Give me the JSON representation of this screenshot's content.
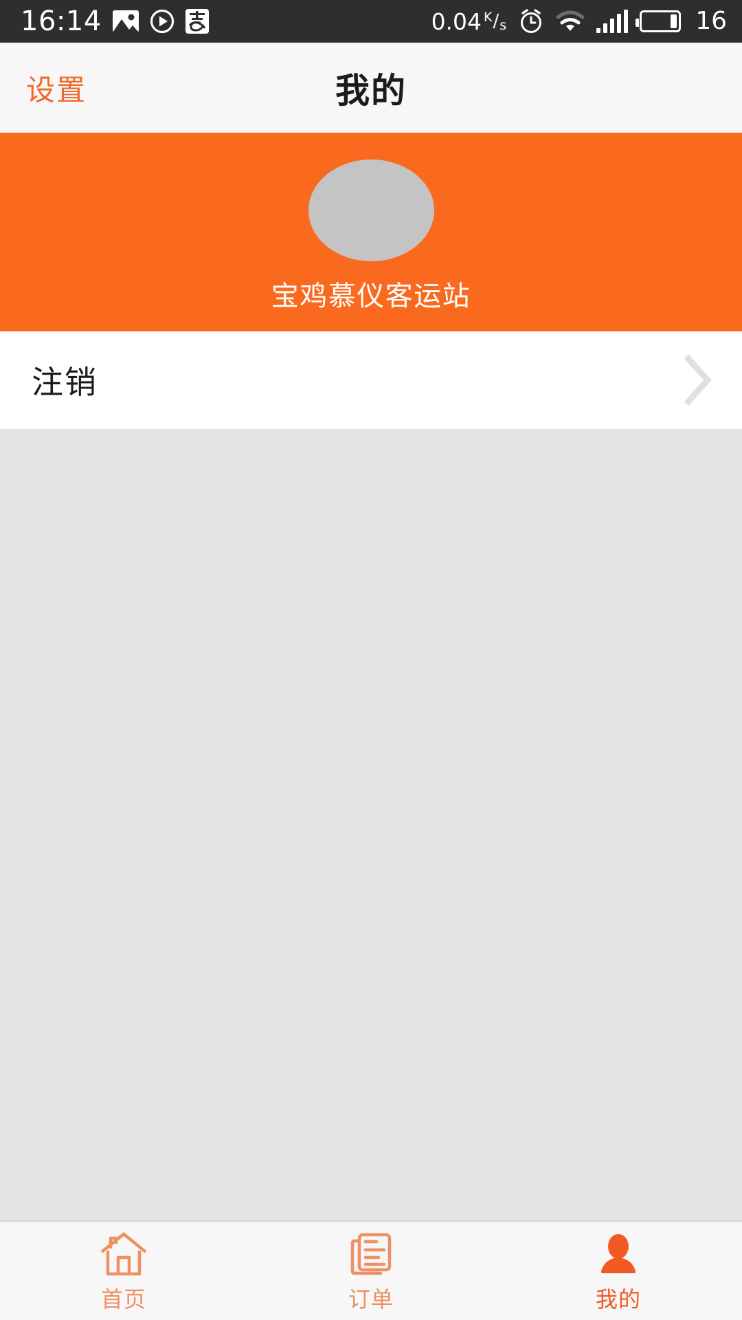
{
  "status_bar": {
    "time": "16:14",
    "icons_left": [
      "image-icon",
      "play-circle-icon",
      "alipay-icon"
    ],
    "network_speed": "0.04",
    "speed_unit_numerator": "K",
    "speed_unit_slash": "/",
    "speed_unit_denominator": "s",
    "icons_right": [
      "alarm-clock-icon",
      "wifi-icon",
      "signal-bars-icon",
      "battery-icon"
    ],
    "battery_level": "16",
    "background_color": "#2e2e2e",
    "foreground_color": "#ffffff"
  },
  "navbar": {
    "left_action": "设置",
    "title": "我的",
    "accent_color": "#f1682a",
    "background_color": "#f7f7f7"
  },
  "profile": {
    "avatar": "avatar-placeholder",
    "username": "宝鸡慕仪客运站",
    "background_color": "#fa6a1e",
    "avatar_color": "#c4c4c4",
    "text_color": "#ffffff"
  },
  "rows": [
    {
      "label": "注销",
      "accessory": "chevron-right-icon"
    }
  ],
  "content": {
    "background_color": "#e4e4e4"
  },
  "tabbar": {
    "background_color": "#f7f7f7",
    "inactive_color": "#ef8f62",
    "active_color": "#f15a22",
    "items": [
      {
        "label": "首页",
        "icon": "home-icon",
        "active": false
      },
      {
        "label": "订单",
        "icon": "orders-document-icon",
        "active": false
      },
      {
        "label": "我的",
        "icon": "person-icon",
        "active": true
      }
    ]
  }
}
